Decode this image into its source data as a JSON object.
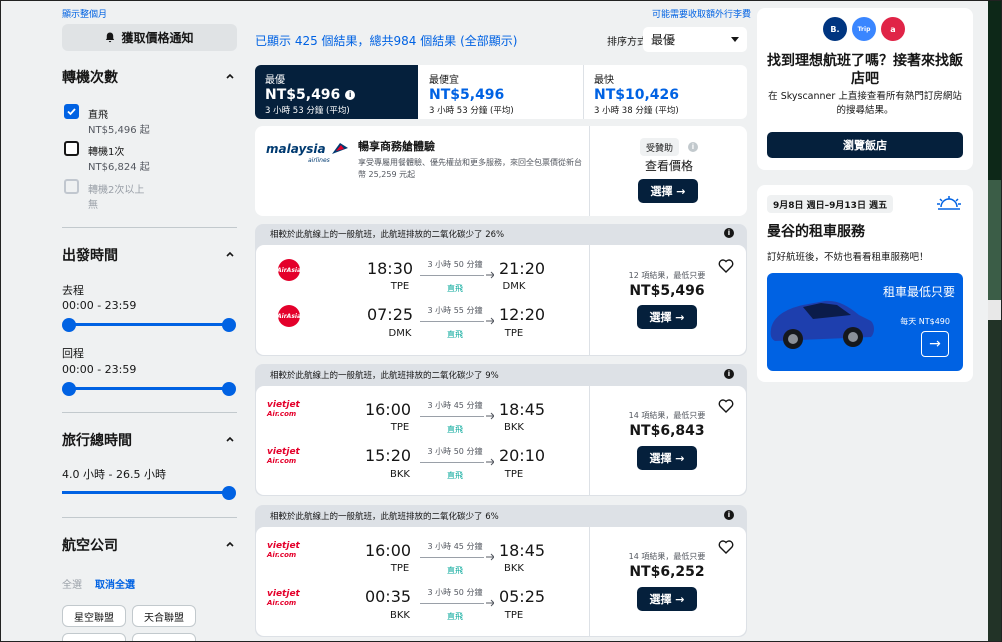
{
  "sidebar": {
    "top_link": "顯示整個月",
    "alert_button": "獲取價格通知",
    "stops": {
      "title": "轉機次數",
      "options": [
        {
          "label": "直飛",
          "sub": "NT$5,496 起"
        },
        {
          "label": "轉機1次",
          "sub": "NT$6,824 起"
        },
        {
          "label": "轉機2次以上",
          "sub": "無"
        }
      ]
    },
    "departure": {
      "title": "出發時間",
      "outbound_label": "去程",
      "outbound_range": "00:00 - 23:59",
      "return_label": "回程",
      "return_range": "00:00 - 23:59"
    },
    "duration": {
      "title": "旅行總時間",
      "range": "4.0 小時 - 26.5 小時"
    },
    "airlines": {
      "title": "航空公司",
      "select_all": "全選",
      "deselect_all": "取消全選",
      "alliances": [
        "星空聯盟",
        "天合聯盟"
      ]
    }
  },
  "header": {
    "results_text": "已顯示 425 個結果，總共984 個結果 (全部顯示)",
    "fees_link": "可能需要收取額外行李費",
    "sort_label": "排序方式",
    "sort_value": "最優"
  },
  "tabs": [
    {
      "label": "最優",
      "price": "NT$5,496",
      "duration": "3 小時 53 分鐘 (平均)"
    },
    {
      "label": "最便宜",
      "price": "NT$5,496",
      "duration": "3 小時 53 分鐘 (平均)"
    },
    {
      "label": "最快",
      "price": "NT$10,426",
      "duration": "3 小時 38 分鐘 (平均)"
    }
  ],
  "ad": {
    "logo_text": "malaysia",
    "logo_sub": "airlines",
    "title": "暢享商務艙體驗",
    "body": "享受專屬用餐體驗、優先權益和更多服務，來回全包票價從新台幣 25,259 元起",
    "sponsored": "受贊助",
    "check_price": "查看價格",
    "select": "選擇 →"
  },
  "results": [
    {
      "eco_note": "相較於此航線上的一般航班，此航班排放的二氧化碳少了 26%",
      "airline": "AirAsia",
      "legs": [
        {
          "dep": "18:30",
          "dep_code": "TPE",
          "duration": "3 小時 50 分鐘",
          "stops": "直飛",
          "arr": "21:20",
          "arr_code": "DMK"
        },
        {
          "dep": "07:25",
          "dep_code": "DMK",
          "duration": "3 小時 55 分鐘",
          "stops": "直飛",
          "arr": "12:20",
          "arr_code": "TPE"
        }
      ],
      "deals": "12 項結果，最低只要",
      "price": "NT$5,496",
      "select": "選擇 →"
    },
    {
      "eco_note": "相較於此航線上的一般航班，此航班排放的二氧化碳少了 9%",
      "airline": "VietJet Air",
      "legs": [
        {
          "dep": "16:00",
          "dep_code": "TPE",
          "duration": "3 小時 45 分鐘",
          "stops": "直飛",
          "arr": "18:45",
          "arr_code": "BKK"
        },
        {
          "dep": "15:20",
          "dep_code": "BKK",
          "duration": "3 小時 50 分鐘",
          "stops": "直飛",
          "arr": "20:10",
          "arr_code": "TPE"
        }
      ],
      "deals": "14 項結果，最低只要",
      "price": "NT$6,843",
      "select": "選擇 →"
    },
    {
      "eco_note": "相較於此航線上的一般航班，此航班排放的二氧化碳少了 6%",
      "airline": "VietJet Air",
      "legs": [
        {
          "dep": "16:00",
          "dep_code": "TPE",
          "duration": "3 小時 45 分鐘",
          "stops": "直飛",
          "arr": "18:45",
          "arr_code": "BKK"
        },
        {
          "dep": "00:35",
          "dep_code": "BKK",
          "duration": "3 小時 50 分鐘",
          "stops": "直飛",
          "arr": "05:25",
          "arr_code": "TPE"
        }
      ],
      "deals": "14 項結果，最低只要",
      "price": "NT$6,252",
      "select": "選擇 →"
    }
  ],
  "hotel_promo": {
    "title": "找到理想航班了嗎？接著來找飯店吧",
    "body": "在 Skyscanner 上直接查看所有熱門訂房網站的搜尋結果。",
    "button": "瀏覽飯店",
    "brands": [
      "B.",
      "Trip",
      "a"
    ]
  },
  "car_promo": {
    "dates": "9月8日 週日–9月13日 週五",
    "title": "曼谷的租車服務",
    "body": "訂好航班後，不妨也看看租車服務吧！",
    "panel_title": "租車最低只要",
    "panel_price": "每天 NT$490",
    "arrow": "→"
  },
  "colors": {
    "accent": "#0062e3",
    "dark": "#05203c",
    "eco": "#00a698",
    "airasia": "#e4002b"
  },
  "icons": [
    "bell-icon",
    "chevron-up-icon",
    "check-icon",
    "info-icon",
    "heart-icon",
    "plane-icon",
    "arrow-right-icon",
    "caret-down-icon",
    "sun-icon"
  ]
}
